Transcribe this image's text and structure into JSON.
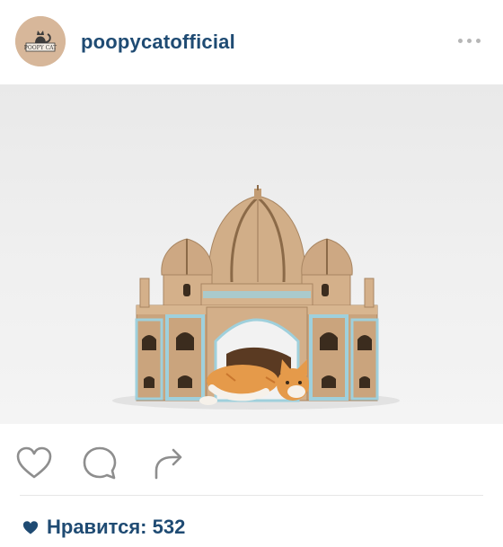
{
  "post": {
    "username": "poopycatofficial",
    "avatar_text": "POOPY CAT",
    "photo_subject": "cardboard-palace-cat-house",
    "likes_label": "Нравится:",
    "likes_count": "532"
  },
  "icons": {
    "more": "more-dots-icon",
    "like": "heart-outline-icon",
    "comment": "comment-bubble-icon",
    "share": "share-arrow-icon",
    "likes_heart": "heart-filled-icon"
  },
  "colors": {
    "username": "#1f4b73",
    "avatar_bg": "#d7b79a",
    "icon_gray": "#8e8e8e",
    "cardboard": "#c9a47e",
    "tile_blue": "#9fd0dc"
  }
}
